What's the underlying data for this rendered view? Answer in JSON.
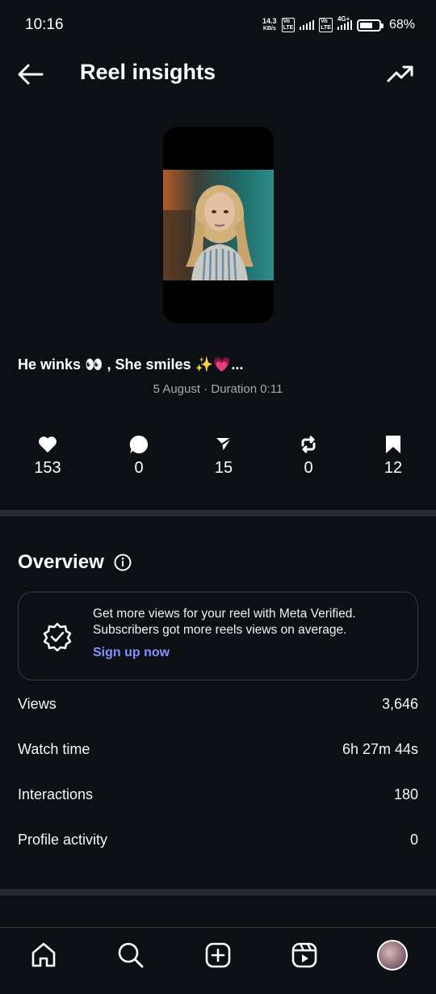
{
  "status_bar": {
    "time": "10:16",
    "net_speed_value": "14.3",
    "net_speed_unit": "KB/s",
    "network_type": "4G+",
    "battery_percent": "68%",
    "battery_level": 0.68
  },
  "header": {
    "title": "Reel insights",
    "back_icon": "arrow-left-icon",
    "trend_icon": "trending-up-icon"
  },
  "reel": {
    "caption": "He winks 👀 , She smiles ✨💗...",
    "meta": "5 August · Duration 0:11"
  },
  "stats": [
    {
      "icon": "heart-icon",
      "value": "153"
    },
    {
      "icon": "comment-icon",
      "value": "0"
    },
    {
      "icon": "share-icon",
      "value": "15"
    },
    {
      "icon": "repost-icon",
      "value": "0"
    },
    {
      "icon": "bookmark-icon",
      "value": "12"
    }
  ],
  "overview": {
    "title": "Overview",
    "info_icon": "info-icon",
    "promo": {
      "text": "Get more views for your reel with Meta Verified. Subscribers got more reels views on average.",
      "link": "Sign up now",
      "icon": "verified-badge-icon"
    },
    "rows": [
      {
        "label": "Views",
        "value": "3,646"
      },
      {
        "label": "Watch time",
        "value": "6h 27m 44s"
      },
      {
        "label": "Interactions",
        "value": "180"
      },
      {
        "label": "Profile activity",
        "value": "0"
      }
    ]
  },
  "bottom_nav": {
    "items": [
      "home-icon",
      "search-icon",
      "create-icon",
      "reels-icon",
      "profile-avatar"
    ]
  },
  "colors": {
    "background": "#0c1014",
    "link": "#8590ff",
    "secondary_text": "#a8a8a8",
    "divider": "#262a2e"
  }
}
